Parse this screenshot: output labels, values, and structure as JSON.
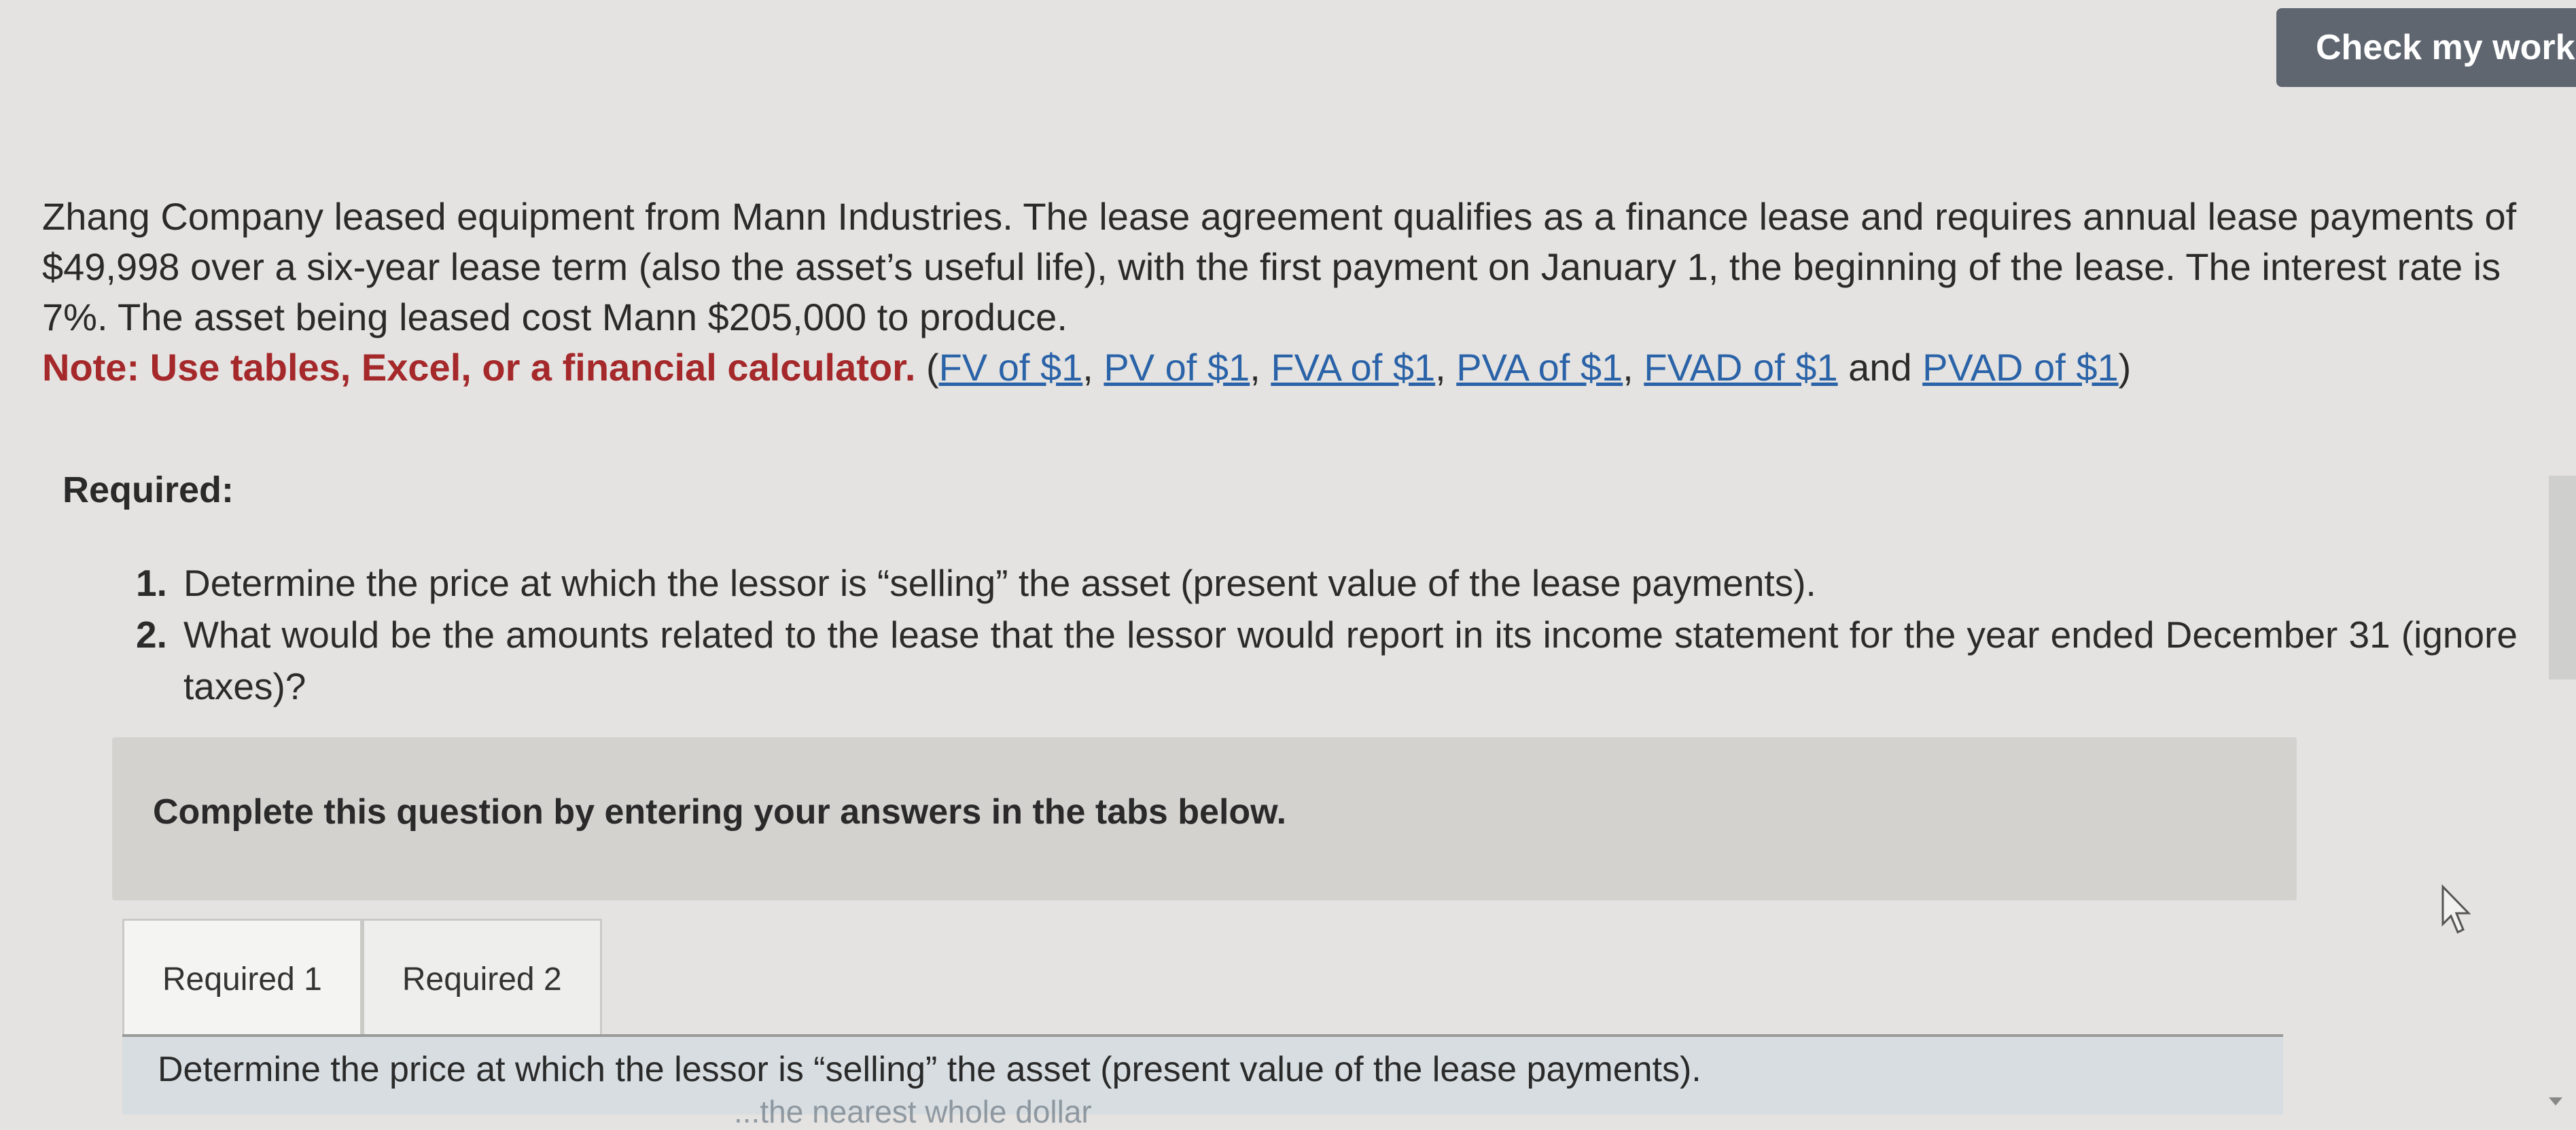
{
  "toolbar": {
    "check_label": "Check my work"
  },
  "problem": {
    "text": "Zhang Company leased equipment from Mann Industries. The lease agreement qualifies as a finance lease and requires annual lease payments of $49,998 over a six-year lease term (also the asset’s useful life), with the first payment on January 1, the beginning of the lease. The interest rate is 7%. The asset being leased cost Mann $205,000 to produce.",
    "note": "Note: Use tables, Excel, or a financial calculator.",
    "links": [
      "FV of $1",
      "PV of $1",
      "FVA of $1",
      "PVA of $1",
      "FVAD of $1",
      "PVAD of $1"
    ],
    "sep": ", ",
    "and": " and ",
    "open": "(",
    "close": ")"
  },
  "required": {
    "heading": "Required:",
    "items": [
      {
        "num": "1.",
        "text": "Determine the price at which the lessor is “selling” the asset (present value of the lease payments)."
      },
      {
        "num": "2.",
        "text": "What would be the amounts related to the lease that the lessor would report in its income statement for the year ended December 31 (ignore taxes)?"
      }
    ]
  },
  "panel": {
    "instruction": "Complete this question by entering your answers in the tabs below."
  },
  "tabs": [
    {
      "label": "Required 1"
    },
    {
      "label": "Required 2"
    }
  ],
  "tab_content": {
    "text": "Determine the price at which the lessor is “selling” the asset (present value of the lease payments).",
    "faded": "...the nearest whole dollar"
  },
  "icons": {
    "cursor": "mouse-pointer-icon",
    "scroll": "scroll-down-arrow-icon"
  }
}
